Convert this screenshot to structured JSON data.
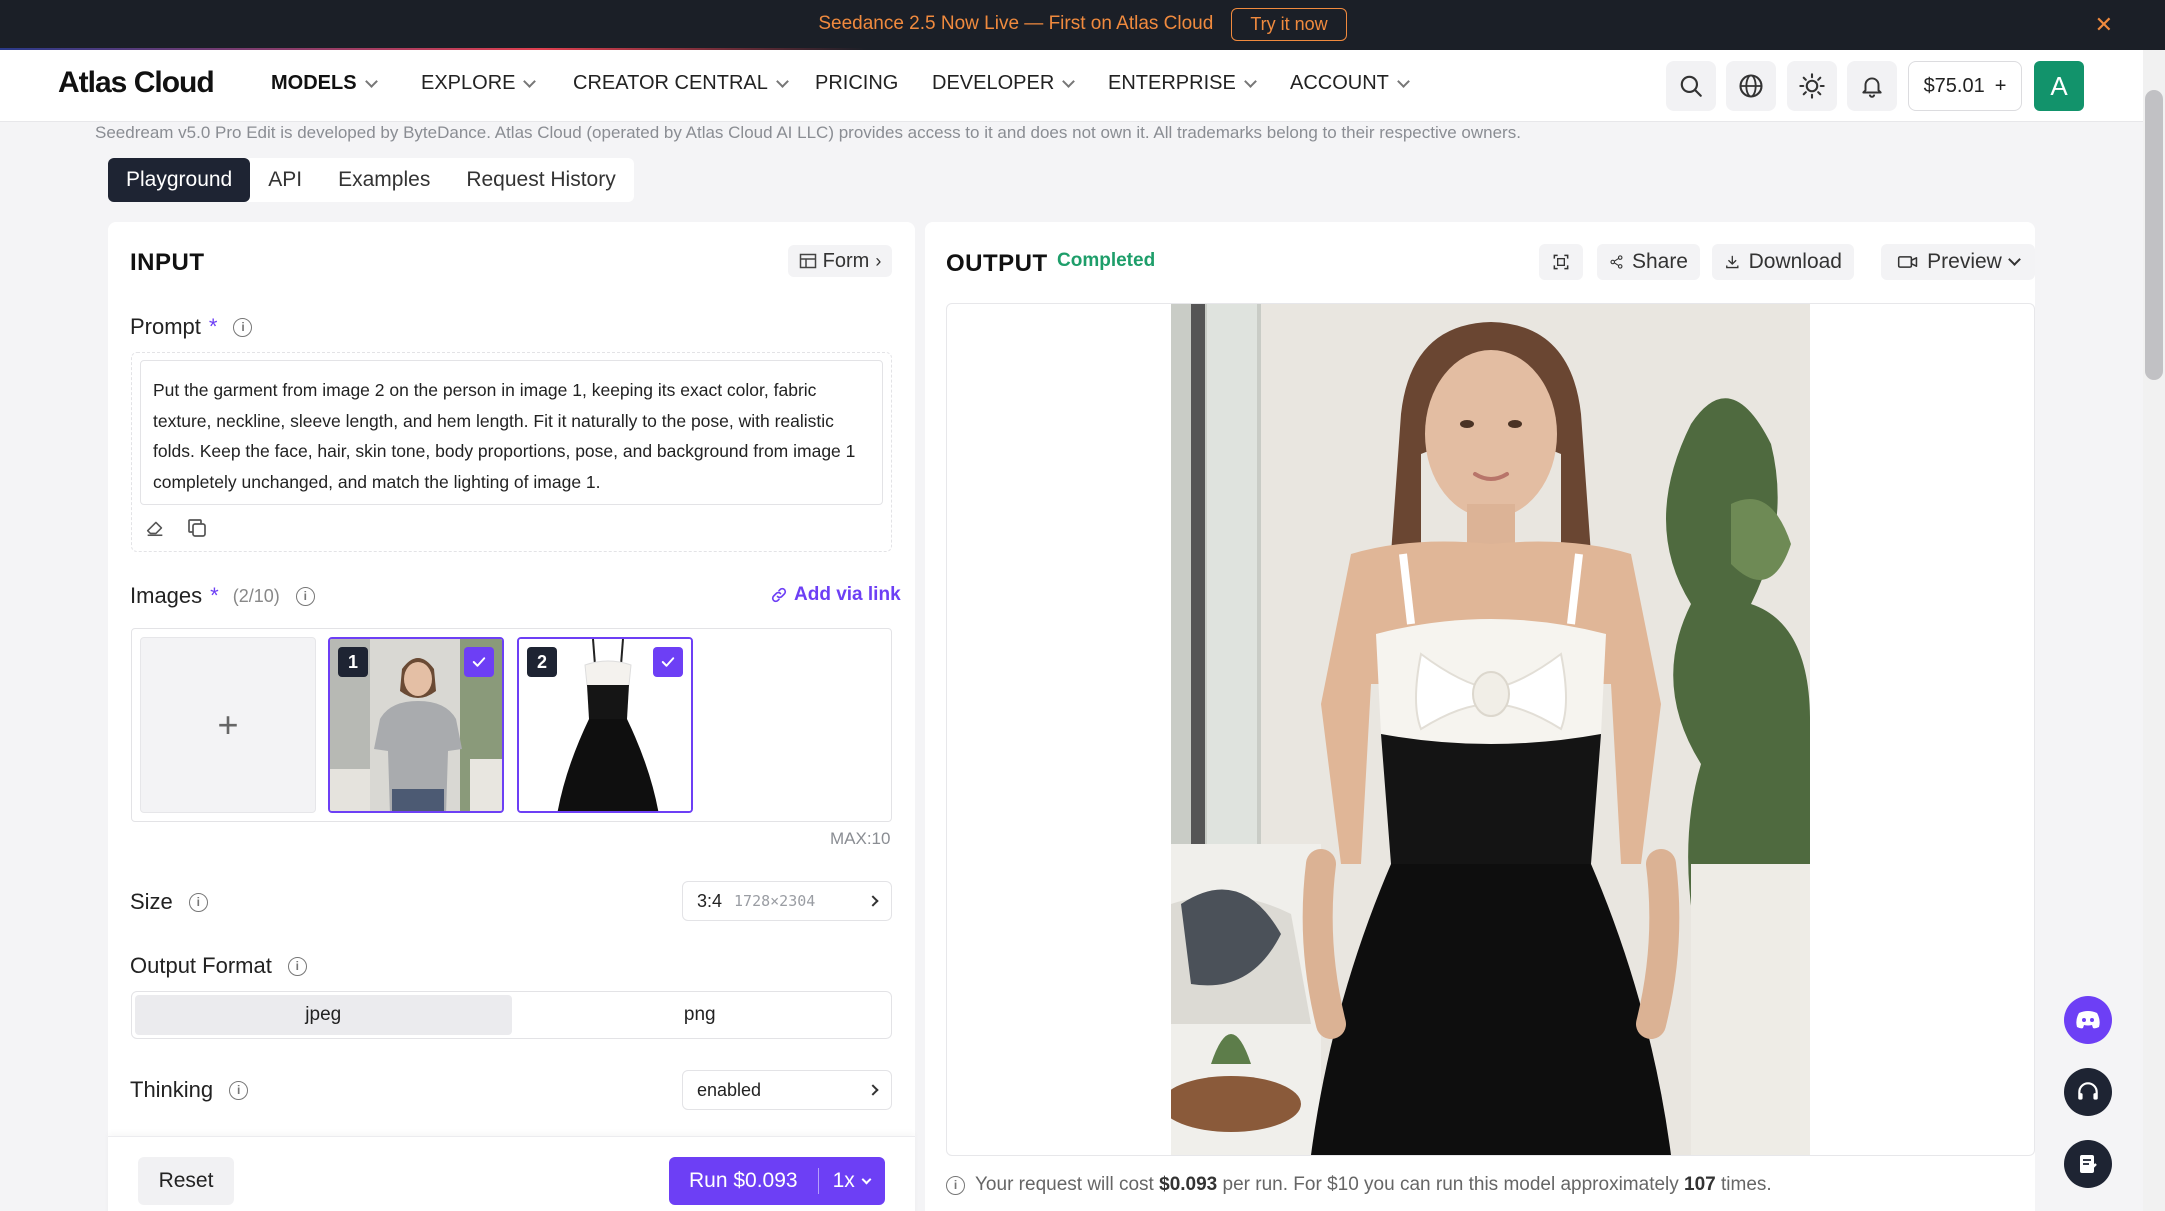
{
  "banner": {
    "text": "Seedance 2.5 Now Live — First on Atlas Cloud",
    "cta": "Try it now",
    "close": "✕"
  },
  "nav": {
    "logo": "Atlas Cloud",
    "items": [
      "MODELS",
      "EXPLORE",
      "CREATOR CENTRAL",
      "PRICING",
      "DEVELOPER",
      "ENTERPRISE",
      "ACCOUNT"
    ],
    "balance": "$75.01",
    "balance_plus": "+",
    "avatar": "A"
  },
  "disclaimer": "Seedream v5.0 Pro Edit is developed by ByteDance. Atlas Cloud (operated by Atlas Cloud AI LLC) provides access to it and does not own it. All trademarks belong to their respective owners.",
  "tabs": [
    "Playground",
    "API",
    "Examples",
    "Request History"
  ],
  "input": {
    "title": "INPUT",
    "form_label": "Form",
    "prompt_label": "Prompt",
    "required": "*",
    "prompt_value": "Put the garment from image 2 on the person in image 1, keeping its exact color, fabric texture, neckline, sleeve length, and hem length. Fit it naturally to the pose, with realistic folds. Keep the face, hair, skin tone, body proportions, pose, and background from image 1 completely unchanged, and match the lighting of image 1.",
    "images_label": "Images",
    "images_count": "(2/10)",
    "add_via_link": "Add via link",
    "add_tile": "+",
    "thumb_1": "1",
    "thumb_2": "2",
    "max_note": "MAX:10",
    "size_label": "Size",
    "size_value": "3:4",
    "size_dims": "1728×2304",
    "format_label": "Output Format",
    "format_options": [
      "jpeg",
      "png"
    ],
    "thinking_label": "Thinking",
    "thinking_value": "enabled",
    "reset": "Reset",
    "run": "Run $0.093",
    "multiplier": "1x"
  },
  "output": {
    "title": "OUTPUT",
    "status": "Completed",
    "share": "Share",
    "download": "Download",
    "preview": "Preview",
    "cost_pre": "Your request will cost",
    "cost_price": "$0.093",
    "cost_mid": "per run. For $10 you can run this model approximately",
    "cost_runs": "107",
    "cost_post": "times."
  },
  "colors": {
    "accent": "#6d3ff5",
    "banner_bg": "#1b1f27",
    "banner_fg": "#f08a3e",
    "status": "#1e9e6a",
    "avatar": "#12936b"
  }
}
